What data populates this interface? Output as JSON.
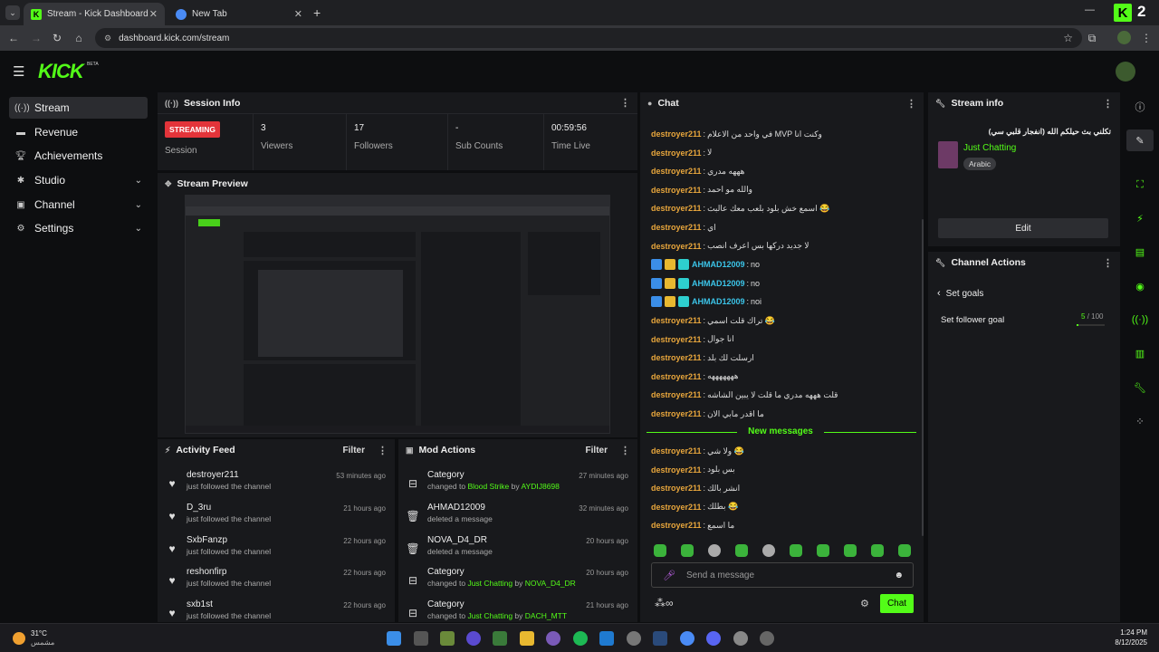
{
  "browser": {
    "tabs": [
      {
        "title": "Stream - Kick Dashboard",
        "icon": "kick-logo-icon"
      },
      {
        "title": "New Tab",
        "icon": "chrome-icon"
      }
    ],
    "new_tab": "+",
    "url": "dashboard.kick.com/stream",
    "window_brand": "2"
  },
  "app": {
    "logo": "KICK",
    "logo_sup": "BETA",
    "accent": "#53fc18"
  },
  "sidebar": {
    "items": [
      {
        "label": "Stream",
        "icon": "broadcast-icon"
      },
      {
        "label": "Revenue",
        "icon": "money-icon"
      },
      {
        "label": "Achievements",
        "icon": "trophy-icon"
      },
      {
        "label": "Studio",
        "icon": "gear-icon"
      },
      {
        "label": "Channel",
        "icon": "channel-icon"
      },
      {
        "label": "Settings",
        "icon": "settings-icon"
      }
    ]
  },
  "session": {
    "title": "Session Info",
    "status": "STREAMING",
    "status_label": "Session",
    "stats": [
      {
        "value": "3",
        "label": "Viewers"
      },
      {
        "value": "17",
        "label": "Followers"
      },
      {
        "value": "-",
        "label": "Sub Counts"
      },
      {
        "value": "00:59:56",
        "label": "Time Live"
      }
    ]
  },
  "preview": {
    "title": "Stream Preview"
  },
  "activity": {
    "title": "Activity Feed",
    "filter": "Filter",
    "items": [
      {
        "name": "destroyer211",
        "action": "just followed the channel",
        "time": "53 minutes ago"
      },
      {
        "name": "D_3ru",
        "action": "just followed the channel",
        "time": "21 hours ago"
      },
      {
        "name": "SxbFanzp",
        "action": "just followed the channel",
        "time": "22 hours ago"
      },
      {
        "name": "reshonfirp",
        "action": "just followed the channel",
        "time": "22 hours ago"
      },
      {
        "name": "sxb1st",
        "action": "just followed the channel",
        "time": "22 hours ago"
      }
    ]
  },
  "mod": {
    "title": "Mod Actions",
    "filter": "Filter",
    "items": [
      {
        "name": "Category",
        "pre": "changed to ",
        "hl": "Blood Strike",
        "mid": " by ",
        "hl2": "AYDIJ8698",
        "time": "27 minutes ago"
      },
      {
        "name": "AHMAD12009",
        "pre": "deleted a message",
        "hl": "",
        "mid": "",
        "hl2": "",
        "time": "32 minutes ago"
      },
      {
        "name": "NOVA_D4_DR",
        "pre": "deleted a message",
        "hl": "",
        "mid": "",
        "hl2": "",
        "time": "20 hours ago"
      },
      {
        "name": "Category",
        "pre": "changed to ",
        "hl": "Just Chatting",
        "mid": " by ",
        "hl2": "NOVA_D4_DR",
        "time": "20 hours ago"
      },
      {
        "name": "Category",
        "pre": "changed to ",
        "hl": "Just Chatting",
        "mid": " by ",
        "hl2": "DACH_MTT",
        "time": "21 hours ago"
      }
    ]
  },
  "chat": {
    "title": "Chat",
    "messages": [
      {
        "user": "destroyer211",
        "text": "في واحد من الاعلام MVP وكنت انا",
        "badges": false
      },
      {
        "user": "destroyer211",
        "text": "لا",
        "badges": false
      },
      {
        "user": "destroyer211",
        "text": "هههه مدري",
        "badges": false
      },
      {
        "user": "destroyer211",
        "text": "والله مو احمد",
        "badges": false
      },
      {
        "user": "destroyer211",
        "text": "اسمع خش بلود بلعب معك عالبث 😂",
        "badges": false
      },
      {
        "user": "destroyer211",
        "text": "اي",
        "badges": false
      },
      {
        "user": "destroyer211",
        "text": "لا جديد دركها بس اعرف انصب",
        "badges": false
      },
      {
        "user": "AHMAD12009",
        "text": "no",
        "badges": true
      },
      {
        "user": "AHMAD12009",
        "text": "no",
        "badges": true
      },
      {
        "user": "AHMAD12009",
        "text": "noi",
        "badges": true
      },
      {
        "user": "destroyer211",
        "text": "تراك قلت اسمي 😂",
        "badges": false
      },
      {
        "user": "destroyer211",
        "text": "انا جوال",
        "badges": false
      },
      {
        "user": "destroyer211",
        "text": "ارسلت لك بلد",
        "badges": false
      },
      {
        "user": "destroyer211",
        "text": "هههههههه",
        "badges": false
      },
      {
        "user": "destroyer211",
        "text": "قلت هههه مدري ما قلت لا يبين الشاشه",
        "badges": false
      },
      {
        "user": "destroyer211",
        "text": "ما اقدر مابي الان",
        "badges": false
      }
    ],
    "new_label": "New messages",
    "new_messages": [
      {
        "user": "destroyer211",
        "text": "ولا شي 😂"
      },
      {
        "user": "destroyer211",
        "text": "بس بلود"
      },
      {
        "user": "destroyer211",
        "text": "انشر بالك"
      },
      {
        "user": "destroyer211",
        "text": "بطلك 😂"
      },
      {
        "user": "destroyer211",
        "text": "ما اسمع"
      }
    ],
    "placeholder": "Send a message",
    "send_label": "Chat"
  },
  "stream_info": {
    "title": "Stream info",
    "stream_title": "تكلني بث حيلكم الله (انفجار قلبي سي)",
    "category": "Just Chatting",
    "language": "Arabic",
    "edit": "Edit"
  },
  "channel_actions": {
    "title": "Channel Actions",
    "back": "Set goals",
    "goal_label": "Set follower goal",
    "goal_value": "5",
    "goal_total": "/ 100",
    "goal_progress": 0.05
  },
  "taskbar": {
    "weather_temp": "31°C",
    "weather_desc": "مشمس",
    "time": "1:24 PM",
    "date": "8/12/2025"
  }
}
